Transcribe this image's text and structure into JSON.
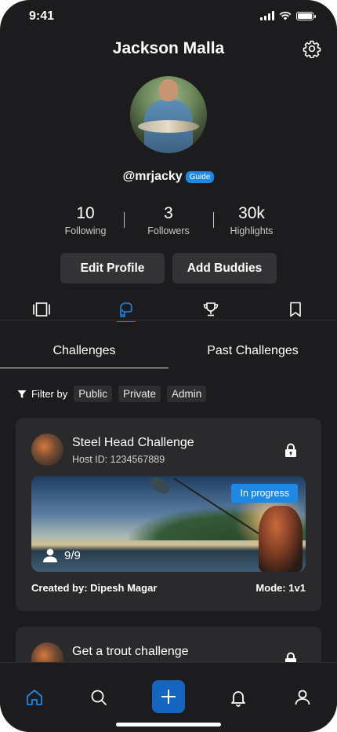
{
  "status": {
    "time": "9:41"
  },
  "profile": {
    "name": "Jackson Malla",
    "handle": "@mrjacky",
    "badge": "Guide",
    "stats": [
      {
        "value": "10",
        "label": "Following"
      },
      {
        "value": "3",
        "label": "Followers"
      },
      {
        "value": "30k",
        "label": "Highlights"
      }
    ],
    "edit_label": "Edit Profile",
    "buddies_label": "Add Buddies"
  },
  "tabs": {
    "icons": [
      "gallery-icon",
      "glove-icon",
      "trophy-icon",
      "bookmark-icon"
    ],
    "active_icon": "glove-icon"
  },
  "segments": {
    "challenges": "Challenges",
    "past": "Past Challenges",
    "active": "Challenges"
  },
  "filter": {
    "label": "Filter by",
    "options": [
      "Public",
      "Private",
      "Admin"
    ]
  },
  "cards": [
    {
      "name": "Steel Head Challenge",
      "host": "Host ID: 1234567889",
      "status": "In progress",
      "participants": "9/9",
      "creator": "Created by: Dipesh Magar",
      "mode": "Mode: 1v1"
    },
    {
      "name": "Get a trout challenge"
    }
  ],
  "nav": {
    "items": [
      "home-icon",
      "search-icon",
      "plus-icon",
      "bell-icon",
      "user-icon"
    ],
    "active": "home-icon"
  },
  "colors": {
    "accent": "#1e88e5",
    "background": "#1c1c1e",
    "card": "#2a2a2c",
    "chip": "#2e2e30"
  }
}
